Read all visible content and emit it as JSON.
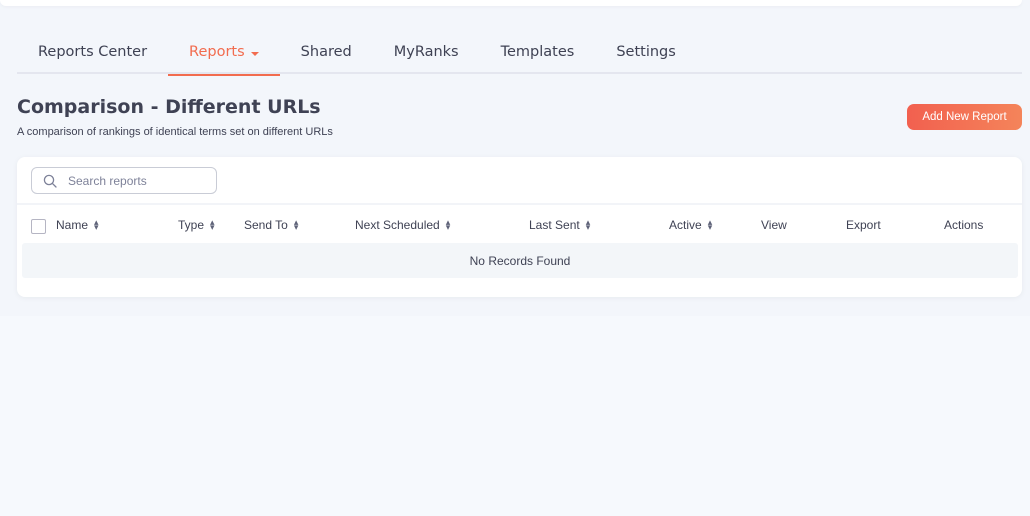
{
  "tabs": [
    {
      "label": "Reports Center",
      "active": false
    },
    {
      "label": "Reports",
      "active": true
    },
    {
      "label": "Shared",
      "active": false
    },
    {
      "label": "MyRanks",
      "active": false
    },
    {
      "label": "Templates",
      "active": false
    },
    {
      "label": "Settings",
      "active": false
    }
  ],
  "page": {
    "title": "Comparison - Different URLs",
    "subtitle": "A comparison of rankings of identical terms set on different URLs",
    "add_button": "Add New Report"
  },
  "search": {
    "placeholder": "Search reports",
    "value": "",
    "icon": "search-icon"
  },
  "table": {
    "columns": [
      {
        "label": "Name",
        "sortable": true
      },
      {
        "label": "Type",
        "sortable": true
      },
      {
        "label": "Send To",
        "sortable": true
      },
      {
        "label": "Next Scheduled",
        "sortable": true
      },
      {
        "label": "Last Sent",
        "sortable": true
      },
      {
        "label": "Active",
        "sortable": true
      },
      {
        "label": "View",
        "sortable": false
      },
      {
        "label": "Export",
        "sortable": false
      },
      {
        "label": "Actions",
        "sortable": false
      }
    ],
    "rows": [],
    "empty_message": "No Records Found"
  },
  "colors": {
    "accent": "#f26c4f",
    "background": "#f3f6fb",
    "text": "#3f4254"
  }
}
